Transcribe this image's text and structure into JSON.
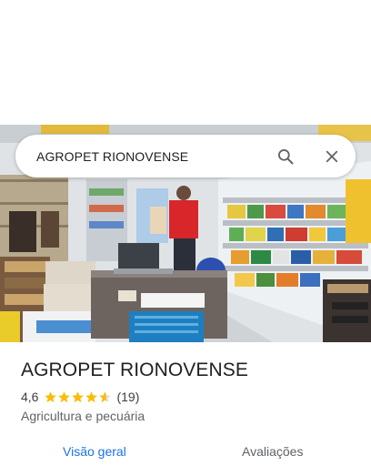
{
  "search": {
    "query": "AGROPET RIONOVENSE"
  },
  "place": {
    "name": "AGROPET RIONOVENSE",
    "rating": "4,6",
    "rating_value": 4.6,
    "review_count": "(19)",
    "category": "Agricultura e pecuária"
  },
  "tabs": [
    {
      "label": "Visão geral",
      "active": true
    },
    {
      "label": "Avaliações",
      "active": false
    }
  ],
  "colors": {
    "accent": "#1a73e8",
    "star": "#fbbc04"
  },
  "icons": [
    "search-icon",
    "close-icon",
    "star-icon"
  ]
}
